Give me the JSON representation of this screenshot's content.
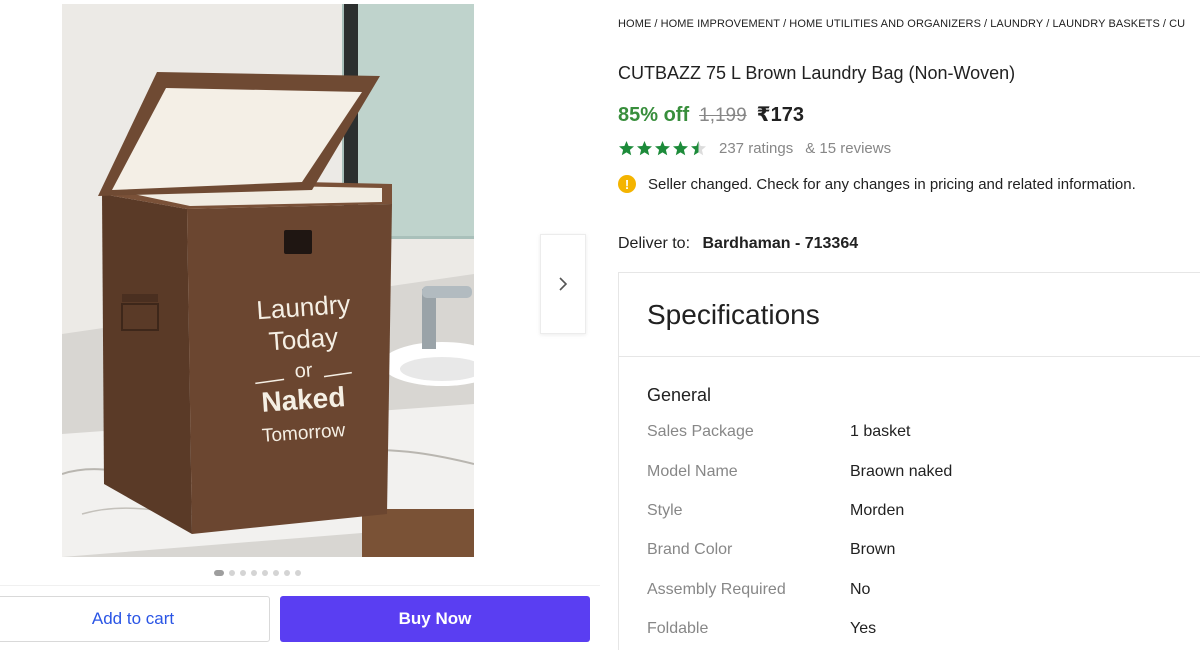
{
  "breadcrumb": [
    "HOME",
    "HOME IMPROVEMENT",
    "HOME UTILITIES AND ORGANIZERS",
    "LAUNDRY",
    "LAUNDRY BASKETS",
    "CU"
  ],
  "product": {
    "title": "CUTBAZZ 75 L Brown Laundry Bag (Non-Woven)",
    "discount": "85% off",
    "mrp": "1,199",
    "price": "₹173",
    "rating_value": 4.5,
    "ratings_text": "237 ratings",
    "reviews_text": "& 15 reviews",
    "image_text": [
      "Laundry",
      "Today",
      "or",
      "Naked",
      "Tomorrow"
    ]
  },
  "notice": {
    "icon": "info-icon",
    "text": "Seller changed. Check for any changes in pricing and related information."
  },
  "delivery": {
    "label": "Deliver to:",
    "location": "Bardhaman - 713364"
  },
  "gallery": {
    "dots": 8,
    "active_dot": 0,
    "next_icon": "chevron-right-icon"
  },
  "actions": {
    "add_to_cart": "Add to cart",
    "buy_now": "Buy Now"
  },
  "specifications": {
    "heading": "Specifications",
    "group": "General",
    "rows": [
      {
        "key": "Sales Package",
        "value": "1 basket"
      },
      {
        "key": "Model Name",
        "value": "Braown naked"
      },
      {
        "key": "Style",
        "value": "Morden"
      },
      {
        "key": "Brand Color",
        "value": "Brown"
      },
      {
        "key": "Assembly Required",
        "value": "No"
      },
      {
        "key": "Foldable",
        "value": "Yes"
      }
    ]
  },
  "colors": {
    "discount": "#388e3c",
    "buy_button": "#5a3ef2",
    "cart_text": "#2a55e5",
    "star": "#1d8b3a",
    "bag": "#6b4630"
  }
}
